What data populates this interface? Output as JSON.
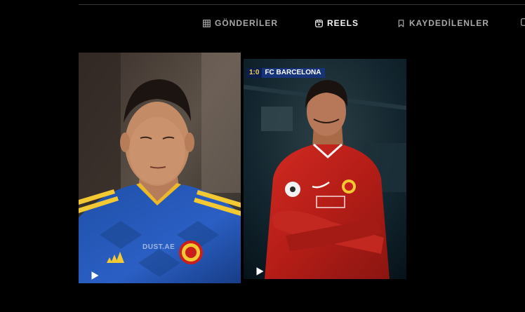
{
  "tabs": [
    {
      "label": "GÖNDERİLER",
      "icon": "grid-icon",
      "active": false
    },
    {
      "label": "REELS",
      "icon": "reels-icon",
      "active": true
    },
    {
      "label": "KAYDEDİLENLER",
      "icon": "bookmark-icon",
      "active": false
    },
    {
      "label": "",
      "icon": "tagged-icon",
      "active": false
    }
  ],
  "reels": [
    {
      "watermark": "DUST.AE",
      "kit_brand": "adidas",
      "play_icon": "play-icon"
    },
    {
      "score": "1:0",
      "team": "FC BARCELONA",
      "play_icon": "play-icon"
    }
  ],
  "colors": {
    "background": "#000000",
    "tab_inactive": "#a8a8a8",
    "tab_active": "#f5f5f5",
    "divider": "#363636"
  }
}
